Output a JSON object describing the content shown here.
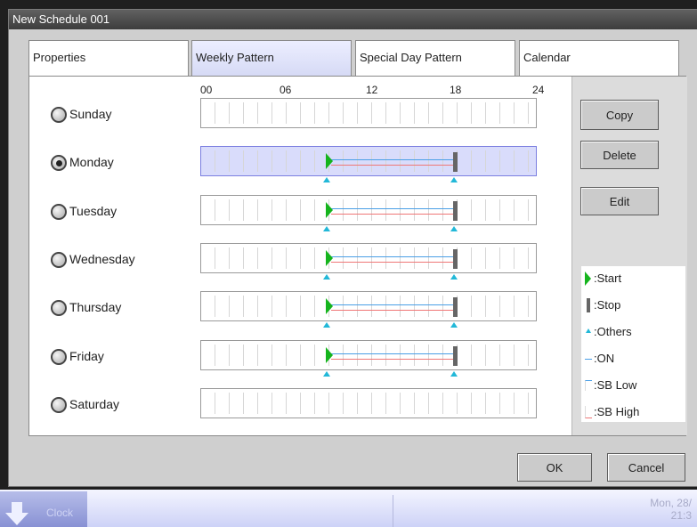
{
  "window": {
    "title": "New Schedule 001"
  },
  "tabs": [
    {
      "label": "Properties",
      "active": false
    },
    {
      "label": "Weekly Pattern",
      "active": true
    },
    {
      "label": "Special Day Pattern",
      "active": false
    },
    {
      "label": "Calendar",
      "active": false
    }
  ],
  "timeline": {
    "hours": [
      "00",
      "06",
      "12",
      "18",
      "24"
    ]
  },
  "days": [
    {
      "label": "Sunday",
      "selected": false,
      "has_events": false
    },
    {
      "label": "Monday",
      "selected": true,
      "has_events": true
    },
    {
      "label": "Tuesday",
      "selected": false,
      "has_events": true
    },
    {
      "label": "Wednesday",
      "selected": false,
      "has_events": true
    },
    {
      "label": "Thursday",
      "selected": false,
      "has_events": true
    },
    {
      "label": "Friday",
      "selected": false,
      "has_events": true
    },
    {
      "label": "Saturday",
      "selected": false,
      "has_events": false
    }
  ],
  "actions": {
    "copy": "Copy",
    "delete": "Delete",
    "edit": "Edit"
  },
  "legend": {
    "start": ":Start",
    "stop": ":Stop",
    "others": ":Others",
    "on": ":ON",
    "sb_low": ":SB Low",
    "sb_high": ":SB High"
  },
  "footer": {
    "ok": "OK",
    "cancel": "Cancel"
  },
  "taskbar": {
    "clock_label": "Clock",
    "date": "Mon, 28/",
    "time": "21:3"
  },
  "colors": {
    "start": "#15b41d",
    "stop": "#666666",
    "others": "#22b8d8",
    "on": "#4a9fe6",
    "sb_high": "#ef7777",
    "selected_row": "#d9dcfb",
    "active_tab": "#dfe2f8"
  }
}
